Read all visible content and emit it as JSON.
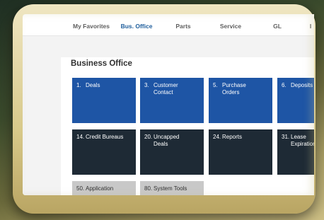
{
  "tabs": [
    {
      "label": "My Favorites"
    },
    {
      "label": "Bus. Office"
    },
    {
      "label": "Parts"
    },
    {
      "label": "Service"
    },
    {
      "label": "GL"
    },
    {
      "label": "I"
    }
  ],
  "page_title": "Business Office",
  "tiles": [
    {
      "num": "1.",
      "label": "Deals"
    },
    {
      "num": "3.",
      "label": "Customer\nContact"
    },
    {
      "num": "5.",
      "label": "Purchase\nOrders"
    },
    {
      "num": "6.",
      "label": "Deposits"
    },
    {
      "num": "14.",
      "label": "Credit Bureaus"
    },
    {
      "num": "20.",
      "label": "Uncapped\nDeals"
    },
    {
      "num": "24.",
      "label": "Reports"
    },
    {
      "num": "31.",
      "label": "Lease\nExpiration"
    },
    {
      "num": "50.",
      "label": "Application"
    },
    {
      "num": "80.",
      "label": "System Tools"
    }
  ],
  "colors": {
    "active_tab": "#1f5e9c",
    "tile_blue": "#1e55a5",
    "tile_dark": "#1e2a35",
    "tile_gray": "#c8c8c8"
  }
}
